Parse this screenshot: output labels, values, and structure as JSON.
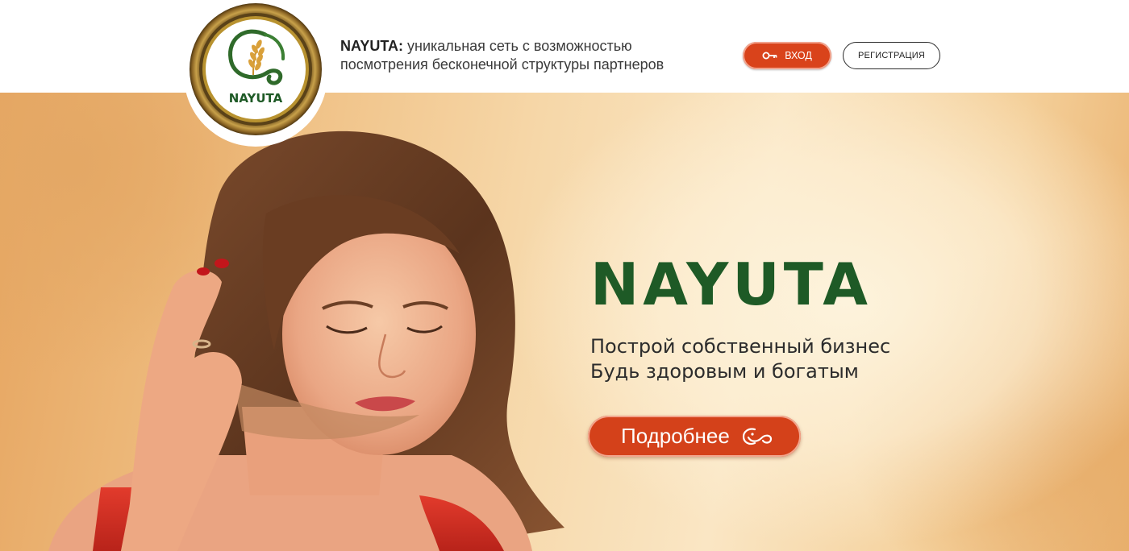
{
  "header": {
    "tagline_brand": "NAYUTA:",
    "tagline_text": "уникальная сеть с возможностью посмотрения бесконечной структуры партнеров",
    "login_label": "ВХОД",
    "register_label": "РЕГИСТРАЦИЯ"
  },
  "logo": {
    "text": "NAYUTA",
    "icon": "wheat-infinity-logo"
  },
  "hero": {
    "brand": "NAYUTA",
    "slogan_line1": "Построй собственный бизнес",
    "slogan_line2": "Будь здоровым и богатым",
    "more_label": "Подробнее",
    "more_icon": "infinity-swirl-icon"
  },
  "colors": {
    "accent": "#d9431b",
    "brand_green": "#1e5a26",
    "logo_gold": "#a27a2a"
  }
}
